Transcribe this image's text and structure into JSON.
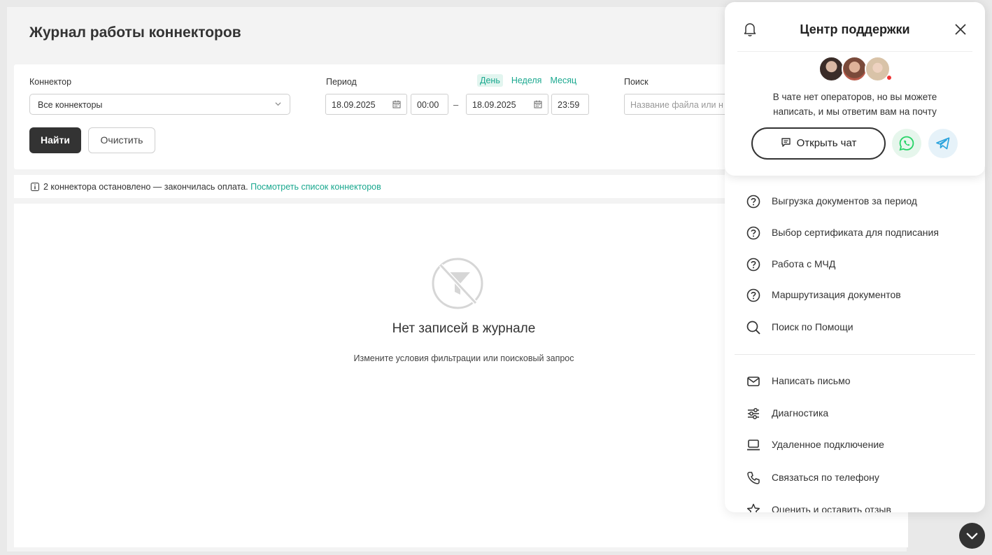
{
  "page": {
    "title": "Журнал работы коннекторов"
  },
  "filters": {
    "connector_label": "Коннектор",
    "connector_value": "Все коннекторы",
    "period_label": "Период",
    "period_links": [
      "День",
      "Неделя",
      "Месяц"
    ],
    "period_active": "День",
    "date_from": "18.09.2025",
    "time_from": "00:00",
    "dash": "–",
    "date_to": "18.09.2025",
    "time_to": "23:59",
    "search_label": "Поиск",
    "search_placeholder": "Название файла или н",
    "find_button": "Найти",
    "clear_button": "Очистить"
  },
  "info": {
    "text": "2 коннектора остановлено — закончилась оплата.",
    "link": "Посмотреть список коннекторов"
  },
  "empty": {
    "title": "Нет записей в журнале",
    "subtitle": "Измените условия фильтрации или поисковый запрос"
  },
  "support": {
    "title": "Центр поддержки",
    "message": "В чате нет операторов, но вы можете написать, и мы ответим вам на почту",
    "open_chat": "Открыть чат",
    "help_items": [
      {
        "label": "Выгрузка документов за период",
        "icon": "question-circle-icon"
      },
      {
        "label": "Выбор сертификата для подписания",
        "icon": "question-circle-icon"
      },
      {
        "label": "Работа с МЧД",
        "icon": "question-circle-icon"
      },
      {
        "label": "Маршрутизация документов",
        "icon": "question-circle-icon"
      },
      {
        "label": "Поиск по Помощи",
        "icon": "search-icon"
      }
    ],
    "contact_items": [
      {
        "label": "Написать письмо",
        "icon": "mail-icon"
      },
      {
        "label": "Диагностика",
        "icon": "sliders-icon"
      },
      {
        "label": "Удаленное подключение",
        "icon": "laptop-icon"
      },
      {
        "label": "Связаться по телефону",
        "icon": "phone-icon"
      },
      {
        "label": "Оценить и оставить отзыв",
        "icon": "star-icon"
      }
    ]
  },
  "colors": {
    "accent": "#1aa88f",
    "primary_button": "#333333",
    "whatsapp": "#25d366",
    "telegram": "#2aa3dd",
    "status_dot": "#e33333"
  }
}
